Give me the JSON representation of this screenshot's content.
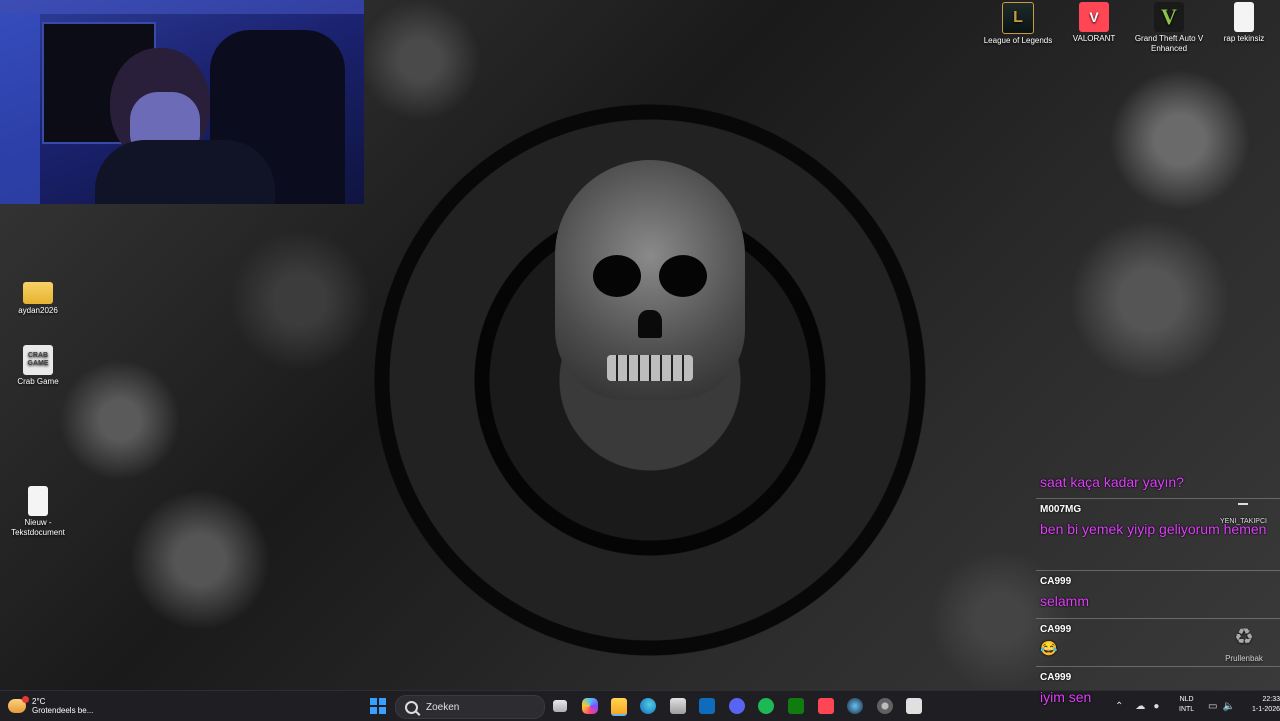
{
  "desktop": {
    "icons_top": [
      {
        "label": "League of Legends",
        "icon": "league-of-legends-icon"
      },
      {
        "label": "VALORANT",
        "icon": "valorant-icon"
      },
      {
        "label": "Grand Theft Auto V Enhanced",
        "icon": "gta-v-icon"
      },
      {
        "label": "rap tekinsiz",
        "icon": "text-document-icon"
      }
    ],
    "icons_left": [
      {
        "label": "aydan2026",
        "icon": "folder-icon"
      },
      {
        "label": "Crab Game",
        "icon": "crab-game-icon"
      },
      {
        "label": "Nieuw - Tekstdocument",
        "icon": "text-document-icon"
      }
    ],
    "recycle_bin": {
      "label": "Prullenbak",
      "icon": "recycle-bin-icon"
    },
    "crab_logo_text": "CRAB GAME"
  },
  "chat": {
    "follow_badge": "YENI_TAKIPCI",
    "messages": [
      {
        "user": "",
        "text": "saat kaça kadar yayın?"
      },
      {
        "user": "M007MG",
        "text": "ben bi yemek yiyip geliyorum hemen"
      },
      {
        "user": "CA999",
        "text": "selamm"
      },
      {
        "user": "CA999",
        "text": "😂"
      },
      {
        "user": "CA999",
        "text": "iyim sen"
      }
    ],
    "colors": {
      "message": "#e040fb",
      "user": "#ffffff"
    }
  },
  "taskbar": {
    "weather_temp": "2°C",
    "weather_desc": "Grotendeels be...",
    "search_placeholder": "Zoeken",
    "apps": [
      "file-explorer-icon",
      "copilot-icon",
      "folder-icon",
      "edge-icon",
      "microsoft-store-icon",
      "outlook-icon",
      "discord-icon",
      "spotify-icon",
      "xbox-icon",
      "valorant-icon",
      "steam-icon",
      "settings-icon",
      "crab-game-icon"
    ],
    "language_1": "NLD",
    "language_2": "INTL",
    "time": "22:33",
    "date": "1-1-2026"
  }
}
